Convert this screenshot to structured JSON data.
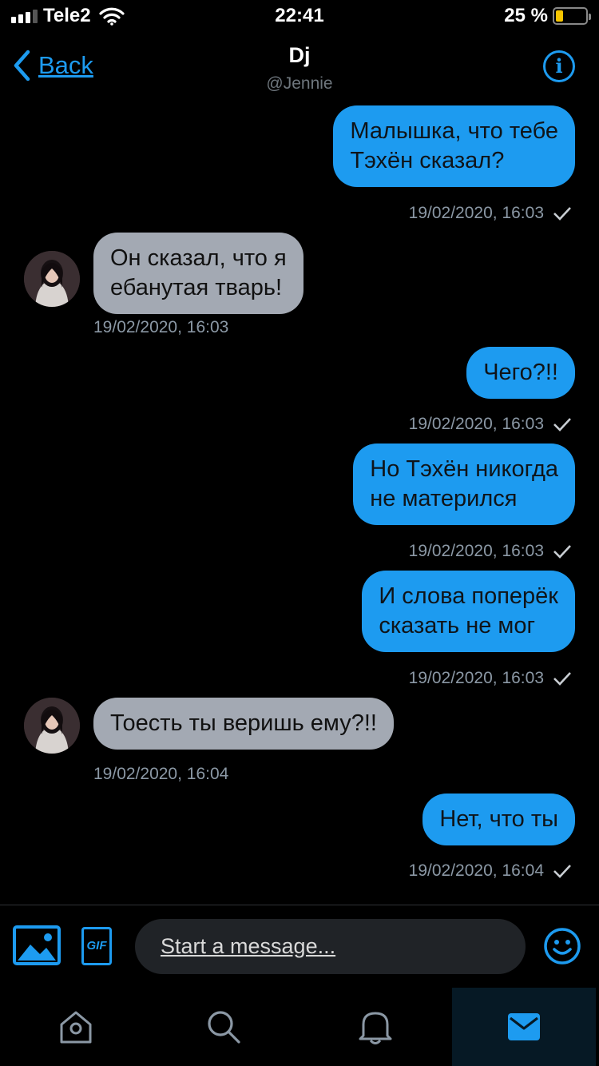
{
  "status_bar": {
    "carrier": "Tele2",
    "time": "22:41",
    "battery": "25 %",
    "battery_level": 0.25
  },
  "header": {
    "back_label": "Back",
    "name": "Dj",
    "handle": "@Jennie"
  },
  "messages": [
    {
      "side": "sent",
      "lines": [
        "Малышка, что тебе",
        "Тэхён сказал?"
      ],
      "time": "19/02/2020, 16:03"
    },
    {
      "side": "received",
      "lines": [
        "Он сказал, что я",
        "ебанутая тварь!"
      ],
      "time": "19/02/2020, 16:03"
    },
    {
      "side": "sent",
      "lines": [
        "Чего?!!"
      ],
      "time": "19/02/2020, 16:03"
    },
    {
      "side": "sent",
      "lines": [
        "Но Тэхён никогда",
        "не матерился"
      ],
      "time": "19/02/2020, 16:03"
    },
    {
      "side": "sent",
      "lines": [
        "И слова поперёк",
        "сказать не мог"
      ],
      "time": "19/02/2020, 16:03"
    },
    {
      "side": "received",
      "lines": [
        "Тоесть ты веришь ему?!!"
      ],
      "time": "19/02/2020, 16:04"
    },
    {
      "side": "sent",
      "lines": [
        "Нет, что ты"
      ],
      "time": "19/02/2020, 16:04"
    }
  ],
  "composer": {
    "gif_label": "GIF",
    "placeholder": "Start a message..."
  },
  "tabs": [
    {
      "icon": "home-icon",
      "active": false
    },
    {
      "icon": "search-icon",
      "active": false
    },
    {
      "icon": "bell-icon",
      "active": false
    },
    {
      "icon": "mail-icon",
      "active": true
    }
  ],
  "colors": {
    "accent": "#1d9bf0",
    "sent_bubble": "#1d9bf0",
    "received_bubble": "#a3a9b3",
    "background": "#000000"
  }
}
